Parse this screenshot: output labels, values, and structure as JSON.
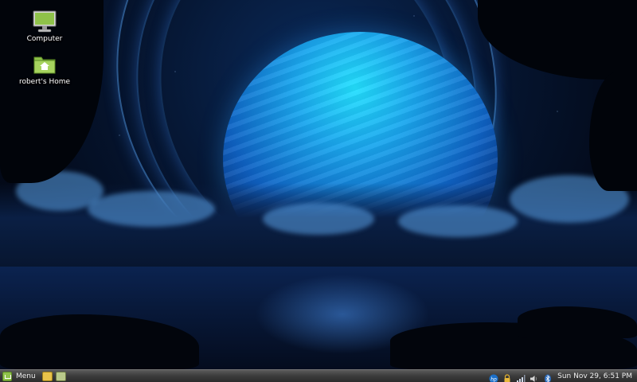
{
  "desktop": {
    "icons": [
      {
        "label": "Computer",
        "icon": "computer-icon"
      },
      {
        "label": "robert's Home",
        "icon": "home-folder-icon"
      }
    ]
  },
  "panel": {
    "menu_label": "Menu",
    "launchers": [
      "file-manager-icon",
      "terminal-icon"
    ],
    "tray_icons": [
      "hp-icon",
      "lock-icon",
      "network-signal-icon",
      "volume-icon",
      "bluetooth-icon"
    ],
    "clock": "Sun Nov 29,  6:51 PM"
  },
  "colors": {
    "panel": "#3b3b3b",
    "mint_green": "#8fc24a",
    "planet": "#1aa6ee"
  }
}
